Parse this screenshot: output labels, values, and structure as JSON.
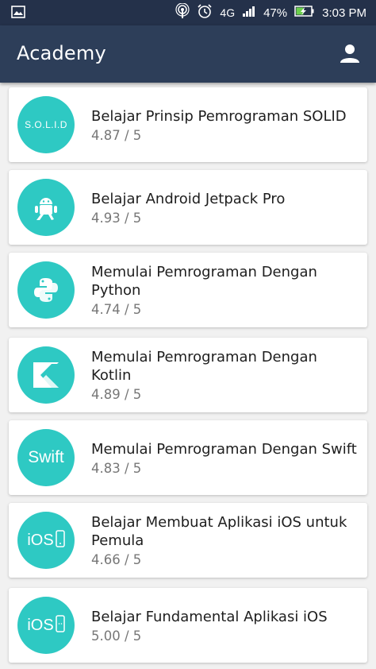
{
  "status_bar": {
    "battery": "47%",
    "time": "3:03 PM",
    "network": "4G",
    "icons": [
      "image-icon",
      "hotspot-icon",
      "alarm-icon",
      "signal-icon",
      "battery-charging-icon"
    ]
  },
  "app_bar": {
    "title": "Academy",
    "profile_icon": "person-icon"
  },
  "colors": {
    "status_bar": "#24314a",
    "app_bar": "#2d3e59",
    "accent": "#2ec9c3",
    "background": "#f1f1f1"
  },
  "courses": [
    {
      "logo": "solid-logo",
      "logo_text": "S.O.L.I.D",
      "title": "Belajar Prinsip Pemrograman SOLID",
      "rating": "4.87 / 5"
    },
    {
      "logo": "android-logo",
      "logo_text": "",
      "title": "Belajar Android Jetpack Pro",
      "rating": "4.93 / 5"
    },
    {
      "logo": "python-logo",
      "logo_text": "",
      "title": "Memulai Pemrograman Dengan Python",
      "rating": "4.74 / 5"
    },
    {
      "logo": "kotlin-logo",
      "logo_text": "",
      "title": "Memulai Pemrograman Dengan Kotlin",
      "rating": "4.89 / 5"
    },
    {
      "logo": "swift-logo",
      "logo_text": "Swift",
      "title": "Memulai Pemrograman Dengan Swift",
      "rating": "4.83 / 5"
    },
    {
      "logo": "ios-logo",
      "logo_text": "iOS",
      "title": "Belajar Membuat Aplikasi iOS untuk Pemula",
      "rating": "4.66 / 5"
    },
    {
      "logo": "ios-logo",
      "logo_text": "iOS",
      "title": "Belajar Fundamental Aplikasi iOS",
      "rating": "5.00 / 5"
    }
  ]
}
